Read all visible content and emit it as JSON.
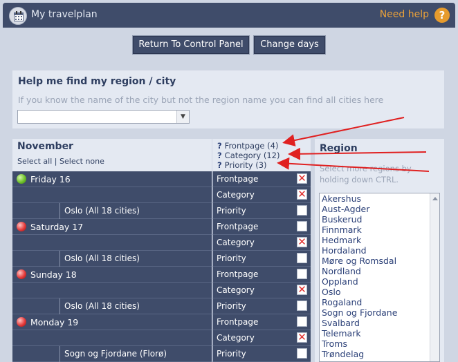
{
  "header": {
    "title": "My travelplan",
    "help_label": "Need help",
    "help_icon": "?"
  },
  "buttons": {
    "return": "Return To Control Panel",
    "change_days": "Change days"
  },
  "region_finder": {
    "title": "Help me find my region / city",
    "hint": "If you know the name of the city but not the region name you can find all cities here",
    "selected": ""
  },
  "calendar": {
    "month": "November",
    "select_all": "Select all",
    "separator": "|",
    "select_none": "Select none",
    "columns": [
      {
        "mark": "?",
        "label": "Frontpage (4)"
      },
      {
        "mark": "?",
        "label": "Category (12)"
      },
      {
        "mark": "?",
        "label": "Priority (3)"
      }
    ],
    "days": [
      {
        "name": "Friday 16",
        "status": "green",
        "location": "Oslo (All 18 cities)",
        "frontpage": "Frontpage",
        "category": "Category",
        "priority": "Priority",
        "fp_mark": "✕",
        "cat_mark": "✕",
        "pri_mark": ""
      },
      {
        "name": "Saturday 17",
        "status": "red",
        "location": "Oslo (All 18 cities)",
        "frontpage": "Frontpage",
        "category": "Category",
        "priority": "Priority",
        "fp_mark": "",
        "cat_mark": "✕",
        "pri_mark": ""
      },
      {
        "name": "Sunday 18",
        "status": "red",
        "location": "Oslo (All 18 cities)",
        "frontpage": "Frontpage",
        "category": "Category",
        "priority": "Priority",
        "fp_mark": "",
        "cat_mark": "✕",
        "pri_mark": ""
      },
      {
        "name": "Monday 19",
        "status": "red",
        "location": "Sogn og Fjordane (Florø)",
        "frontpage": "Frontpage",
        "category": "Category",
        "priority": "Priority",
        "fp_mark": "",
        "cat_mark": "✕",
        "pri_mark": ""
      }
    ]
  },
  "region_panel": {
    "title": "Region",
    "hint": "Select more regions by holding down CTRL.",
    "regions": [
      "Akershus",
      "Aust-Agder",
      "Buskerud",
      "Finnmark",
      "Hedmark",
      "Hordaland",
      "Møre og Romsdal",
      "Nordland",
      "Oppland",
      "Oslo",
      "Rogaland",
      "Sogn og Fjordane",
      "Svalbard",
      "Telemark",
      "Troms",
      "Trøndelag"
    ]
  },
  "colors": {
    "header_bg": "#3f4c6a",
    "panel_bg": "#e4e9f2",
    "page_bg": "#cfd6e3",
    "help_accent": "#e69b2d",
    "arrow": "#e02020"
  }
}
